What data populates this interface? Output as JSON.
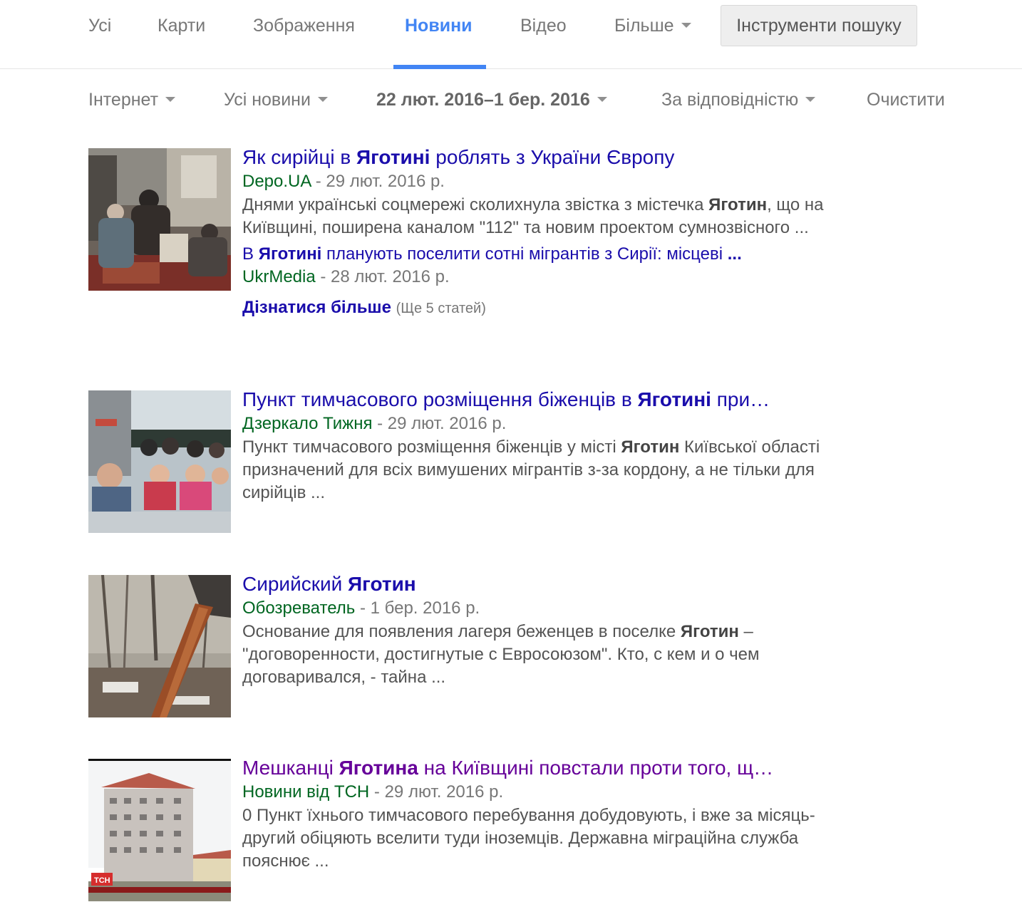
{
  "tabs": [
    {
      "label": "Усі"
    },
    {
      "label": "Карти"
    },
    {
      "label": "Зображення"
    },
    {
      "label": "Новини"
    },
    {
      "label": "Відео"
    },
    {
      "label": "Більше"
    }
  ],
  "tools_button": "Інструменти пошуку",
  "filters": {
    "source": "Інтернет",
    "type": "Усі новини",
    "date_range": "22 лют. 2016–1 бер. 2016",
    "sort": "За відповідністю",
    "clear": "Очистити"
  },
  "results": [
    {
      "title_pre": "Як сирійці в ",
      "title_bold": "Яготині",
      "title_post": " роблять з України Європу",
      "source": "Depo.UA",
      "date": " - 29 лют. 2016 р.",
      "snippet_pre": "Днями українські соцмережі сколихнула звістка з містечка ",
      "snippet_bold": "Яготин",
      "snippet_post": ", що на Київщині, поширена каналом \"112\" та новим проектом сумнозвісного ...",
      "sub_title_pre": "В ",
      "sub_title_bold": "Яготині",
      "sub_title_post": " планують поселити сотні мігрантів з Сирії: місцеві ",
      "sub_title_ellipsis": "...",
      "sub_source": "UkrMedia",
      "sub_date": " - 28 лют. 2016 р.",
      "more_label": "Дізнатися більше",
      "more_count": "(Ще 5 статей)"
    },
    {
      "title_pre": "Пункт тимчасового розміщення біженців в ",
      "title_bold": "Яготині",
      "title_post": " при…",
      "source": "Дзеркало Тижня",
      "date": " - 29 лют. 2016 р.",
      "snippet_pre": "Пункт тимчасового розміщення біженців у місті ",
      "snippet_bold": "Яготин",
      "snippet_post": " Київської області призначений для всіх вимушених мігрантів з-за кордону, а не тільки для сирійців ..."
    },
    {
      "title_pre": "Сирийский ",
      "title_bold": "Яготин",
      "title_post": "",
      "source": "Обозреватель",
      "date": " - 1 бер. 2016 р.",
      "snippet_pre": "Основание для появления лагеря беженцев в поселке ",
      "snippet_bold": "Яготин",
      "snippet_post": " – \"договоренности, достигнутые с Евросоюзом\". Кто, с кем и о чем договаривался, - тайна ..."
    },
    {
      "title_pre": "Мешканці ",
      "title_bold": "Яготина",
      "title_post": " на Київщині повстали проти того, щ…",
      "source": "Новини від ТСН",
      "date": " - 29 лют. 2016 р.",
      "snippet_pre": "0 Пункт їхнього тимчасового перебування добудовують, і вже за місяць-другий обіцяють вселити туди іноземців. Державна міграційна служба пояснює ...",
      "snippet_bold": "",
      "snippet_post": "",
      "thumb_logo": "ТСН"
    }
  ],
  "colors": {
    "accent": "#4285f4",
    "link": "#1a0dab",
    "visited": "#660099",
    "source": "#006621"
  }
}
